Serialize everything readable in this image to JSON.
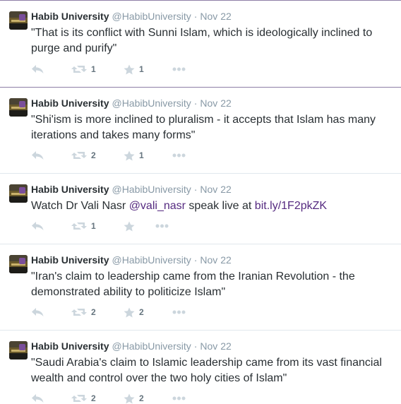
{
  "tweets": [
    {
      "name": "Habib University",
      "handle": "@HabibUniversity",
      "separator": "·",
      "date": "Nov 22",
      "text": "\"That is its conflict with Sunni Islam, which is ideologically inclined to purge and purify\"",
      "retweets": "1",
      "favorites": "1"
    },
    {
      "name": "Habib University",
      "handle": "@HabibUniversity",
      "separator": "·",
      "date": "Nov 22",
      "text": "\"Shi'ism is more inclined to pluralism - it accepts that Islam has many iterations and takes many forms\"",
      "retweets": "2",
      "favorites": "1"
    },
    {
      "name": "Habib University",
      "handle": "@HabibUniversity",
      "separator": "·",
      "date": "Nov 22",
      "text_before": "Watch Dr Vali Nasr ",
      "mention": "@vali_nasr",
      "text_middle": " speak live at ",
      "url": "bit.ly/1F2pkZK",
      "retweets": "1",
      "favorites": ""
    },
    {
      "name": "Habib University",
      "handle": "@HabibUniversity",
      "separator": "·",
      "date": "Nov 22",
      "text": "\"Iran's claim to leadership came from the Iranian Revolution - the demonstrated ability to politicize Islam\"",
      "retweets": "2",
      "favorites": "2"
    },
    {
      "name": "Habib University",
      "handle": "@HabibUniversity",
      "separator": "·",
      "date": "Nov 22",
      "text": "\"Saudi Arabia's claim to Islamic leadership came from its vast financial wealth and control over the two holy cities of Islam\"",
      "retweets": "2",
      "favorites": "2"
    }
  ],
  "icons": {
    "reply": "reply-icon",
    "retweet": "retweet-icon",
    "favorite": "star-icon",
    "more": "more-icon"
  },
  "colors": {
    "name": "#292f33",
    "meta": "#8899a6",
    "link": "#552a80",
    "action_icon": "#ccd6dd",
    "count": "#66757f",
    "divider_accent": "#8e7fa6",
    "divider": "#e1e8ed"
  }
}
